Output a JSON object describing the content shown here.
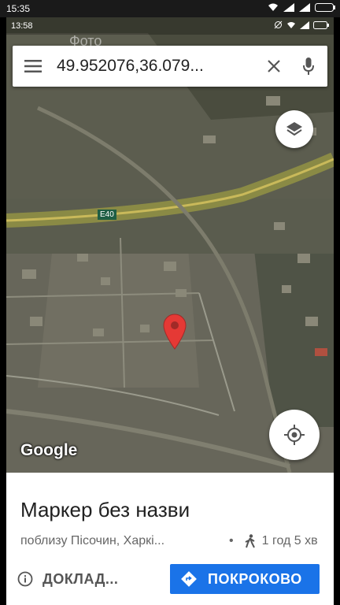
{
  "outer_status": {
    "time": "15:35"
  },
  "inner_status": {
    "time": "13:58"
  },
  "ghost_text": "Фото",
  "search": {
    "query": "49.952076,36.079..."
  },
  "map": {
    "road_label": "E40",
    "attribution": "Google"
  },
  "place": {
    "title": "Маркер без назви",
    "address": "поблизу Пісочин, Харкі...",
    "separator": "•",
    "walk_time": "1 год 5 хв"
  },
  "actions": {
    "details_label": "ДОКЛАД...",
    "directions_label": "ПОКРОКОВО"
  },
  "colors": {
    "accent": "#1a73e8",
    "pin": "#e53935"
  }
}
